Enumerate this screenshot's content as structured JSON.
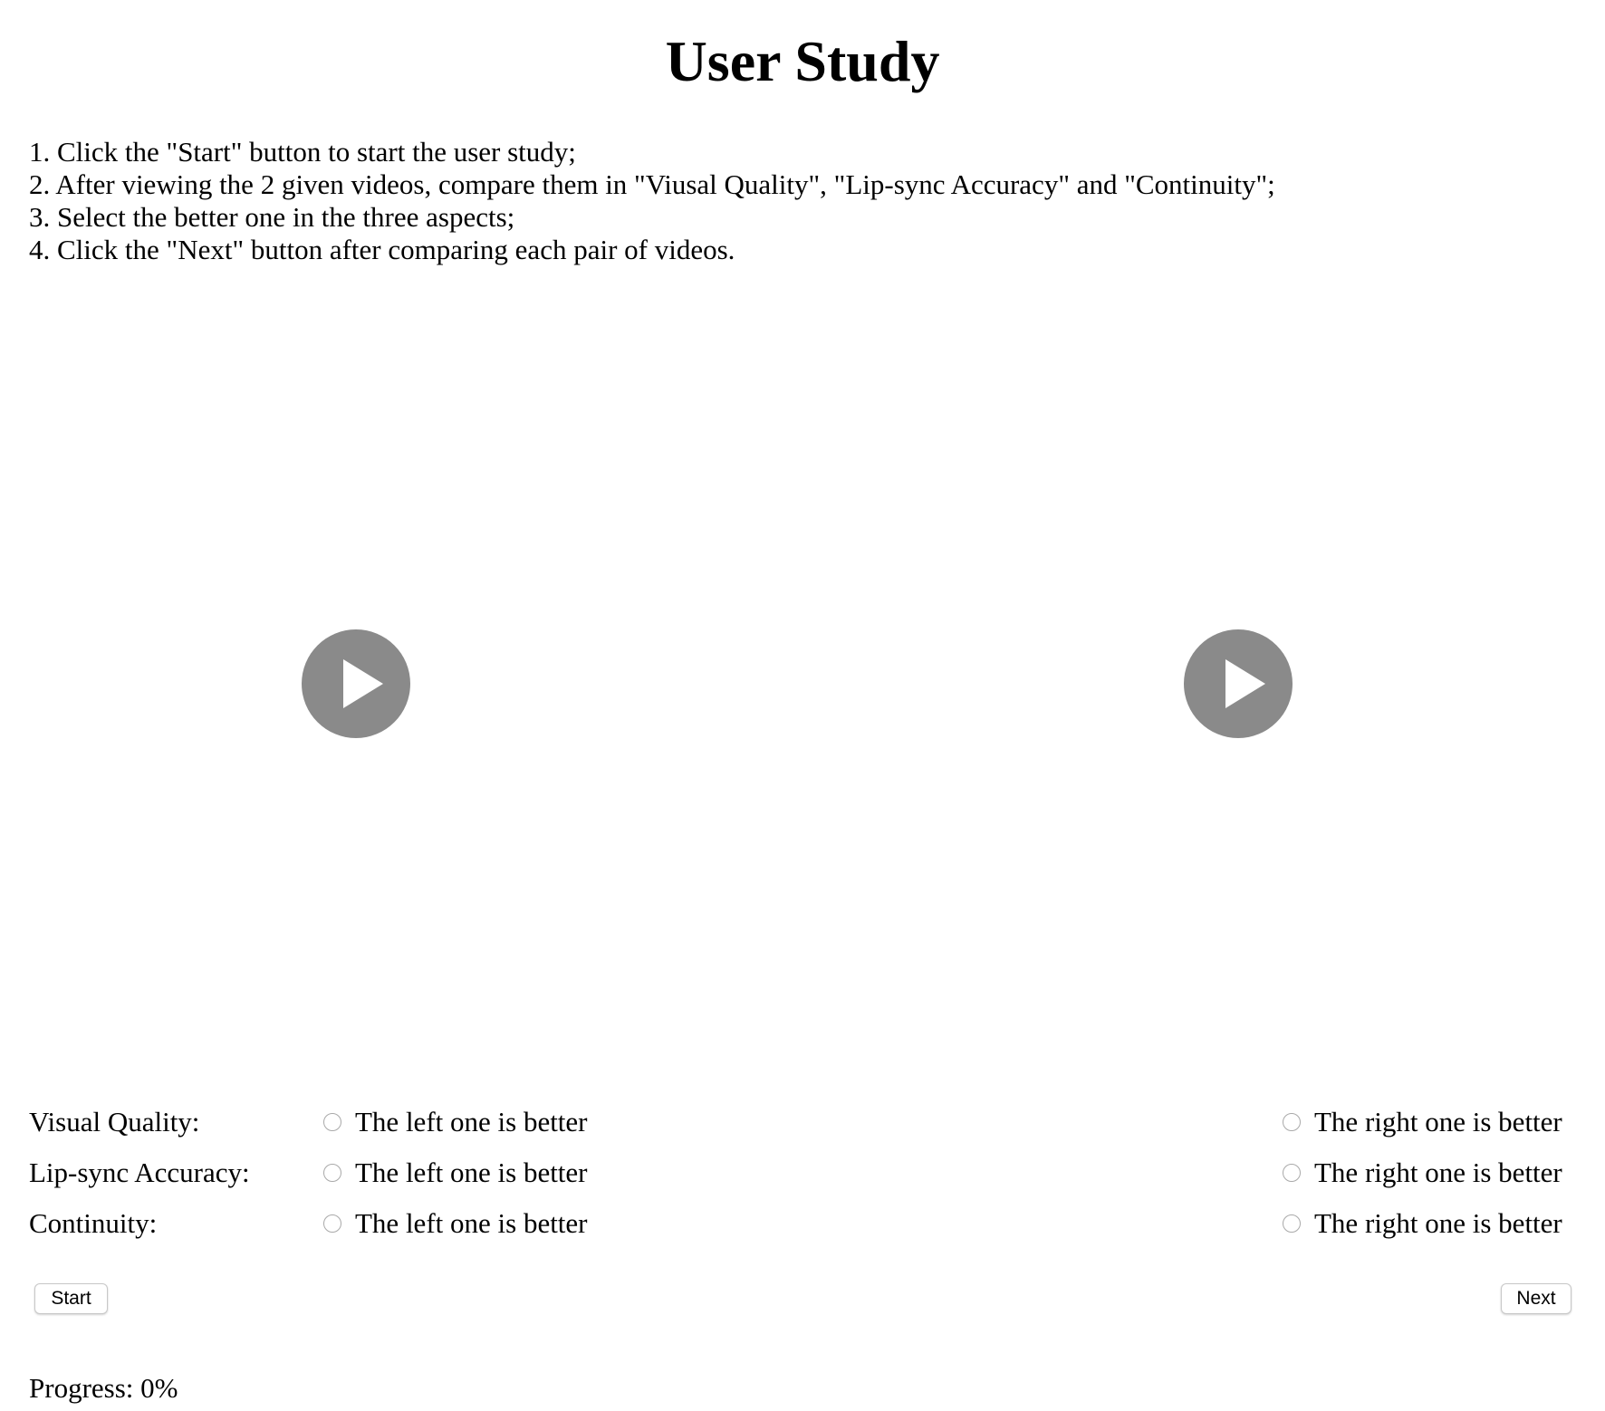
{
  "page": {
    "title": "User Study"
  },
  "instructions": [
    "1. Click the \"Start\" button to start the user study;",
    "2. After viewing the 2 given videos, compare them in \"Viusal Quality\", \"Lip-sync Accuracy\" and \"Continuity\";",
    "3. Select the better one in the three aspects;",
    "4. Click the \"Next\" button after comparing each pair of videos."
  ],
  "videos": {
    "left": {
      "icon": "play-icon"
    },
    "right": {
      "icon": "play-icon"
    },
    "play_button_color": "#8a8a8a"
  },
  "ratings": [
    {
      "label": "Visual Quality:",
      "left_option": "The left one is better",
      "right_option": "The right one is better"
    },
    {
      "label": "Lip-sync Accuracy:",
      "left_option": "The left one is better",
      "right_option": "The right one is better"
    },
    {
      "label": "Continuity:",
      "left_option": "The left one is better",
      "right_option": "The right one is better"
    }
  ],
  "buttons": {
    "start_label": "Start",
    "next_label": "Next"
  },
  "progress": {
    "text": "Progress: 0%",
    "value": 0
  }
}
